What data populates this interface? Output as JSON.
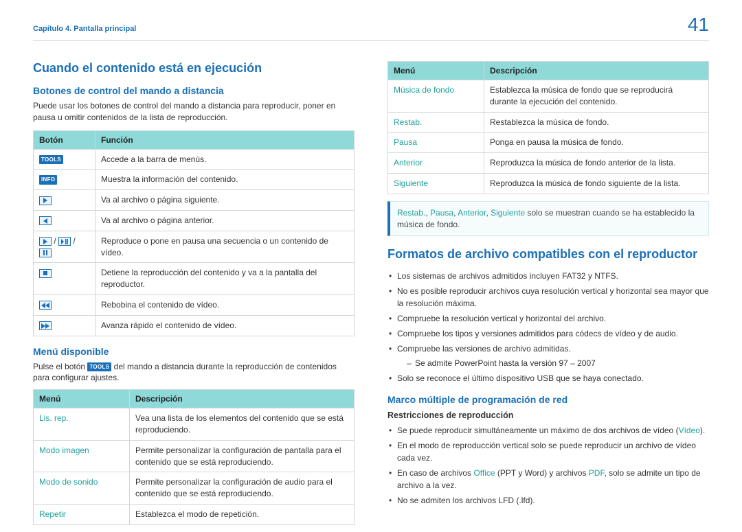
{
  "page": {
    "chapter": "Capítulo 4. Pantalla principal",
    "number": "41"
  },
  "left": {
    "h1": "Cuando el contenido está en ejecución",
    "h2a": "Botones de control del mando a distancia",
    "p1": "Puede usar los botones de control del mando a distancia para reproducir, poner en pausa u omitir contenidos de la lista de reproducción.",
    "buttons_table": {
      "head": {
        "c1": "Botón",
        "c2": "Función"
      },
      "rows": [
        {
          "icon": "TOOLS",
          "desc": "Accede a la barra de menús."
        },
        {
          "icon": "INFO",
          "desc": "Muestra la información del contenido."
        },
        {
          "icon": "play-right",
          "desc": "Va al archivo o página siguiente."
        },
        {
          "icon": "play-left",
          "desc": "Va al archivo o página anterior."
        },
        {
          "icon": "play-pause-group",
          "desc": "Reproduce o pone en pausa una secuencia o un contenido de vídeo."
        },
        {
          "icon": "stop",
          "desc": "Detiene la reproducción del contenido y va a la pantalla del reproductor."
        },
        {
          "icon": "rewind",
          "desc": "Rebobina el contenido de vídeo."
        },
        {
          "icon": "ffwd",
          "desc": "Avanza rápido el contenido de vídeo."
        }
      ]
    },
    "h2b": "Menú disponible",
    "p2_pre": "Pulse el botón ",
    "p2_tools": "TOOLS",
    "p2_post": " del mando a distancia durante la reproducción de contenidos para configurar ajustes.",
    "menu_table": {
      "head": {
        "c1": "Menú",
        "c2": "Descripción"
      },
      "rows": [
        {
          "name": "Lis. rep.",
          "desc": "Vea una lista de los elementos del contenido que se está reproduciendo."
        },
        {
          "name": "Modo imagen",
          "desc": "Permite personalizar la configuración de pantalla para el contenido que se está reproduciendo."
        },
        {
          "name": "Modo de sonido",
          "desc": "Permite personalizar la configuración de audio para el contenido que se está reproduciendo."
        },
        {
          "name": "Repetir",
          "desc": "Establezca el modo de repetición."
        }
      ]
    }
  },
  "right": {
    "menu_table2": {
      "head": {
        "c1": "Menú",
        "c2": "Descripción"
      },
      "rows": [
        {
          "name": "Música de fondo",
          "desc": "Establezca la música de fondo que se reproducirá durante la ejecución del contenido."
        },
        {
          "name": "Restab.",
          "desc": "Restablezca la música de fondo."
        },
        {
          "name": "Pausa",
          "desc": "Ponga en pausa la música de fondo."
        },
        {
          "name": "Anterior",
          "desc": "Reproduzca la música de fondo anterior de la lista."
        },
        {
          "name": "Siguiente",
          "desc": "Reproduzca la música de fondo siguiente de la lista."
        }
      ]
    },
    "callout": {
      "kw1": "Restab.",
      "kw2": "Pausa",
      "kw3": "Anterior",
      "kw4": "Siguiente",
      "text_mid": " solo se muestran cuando se ha establecido la música de fondo."
    },
    "h1b": "Formatos de archivo compatibles con el reproductor",
    "bullets1": [
      "Los sistemas de archivos admitidos incluyen FAT32 y NTFS.",
      "No es posible reproducir archivos cuya resolución vertical y horizontal sea mayor que la resolución máxima.",
      "Compruebe la resolución vertical y horizontal del archivo.",
      "Compruebe los tipos y versiones admitidos para códecs de vídeo y de audio.",
      "Compruebe las versiones de archivo admitidas."
    ],
    "bullets1_sub": "Se admite PowerPoint hasta la versión 97 – 2007",
    "bullets1_last": "Solo se reconoce el último dispositivo USB que se haya conectado.",
    "h2c": "Marco múltiple de programación de red",
    "h3": "Restricciones de reproducción",
    "bullets2": {
      "b1_pre": "Se puede reproducir simultáneamente un máximo de dos archivos de vídeo (",
      "b1_kw": "Vídeo",
      "b1_post": ").",
      "b2": "En el modo de reproducción vertical solo se puede reproducir un archivo de vídeo cada vez.",
      "b3_pre": "En caso de archivos ",
      "b3_kw1": "Office",
      "b3_mid": " (PPT y Word) y archivos ",
      "b3_kw2": "PDF",
      "b3_post": ", solo se admite un tipo de archivo a la vez.",
      "b4": "No se admiten los archivos LFD (.lfd)."
    }
  }
}
